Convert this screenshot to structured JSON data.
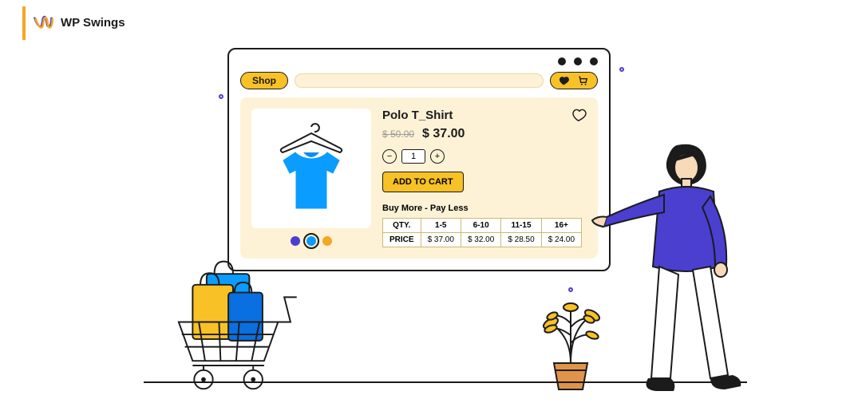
{
  "brand": {
    "name": "WP Swings"
  },
  "header": {
    "shop_label": "Shop"
  },
  "product": {
    "title": "Polo T_Shirt",
    "old_price": "$ 50.00",
    "new_price": "$ 37.00",
    "qty": "1",
    "add_to_cart": "ADD TO CART",
    "tier_title": "Buy More - Pay Less",
    "swatches": [
      "#4a3fcf",
      "#0a9cff",
      "#f5a623"
    ],
    "swatch_selected": 1,
    "table": {
      "headers": [
        "QTY.",
        "1-5",
        "6-10",
        "11-15",
        "16+"
      ],
      "row_label": "PRICE",
      "prices": [
        "$ 37.00",
        "$ 32.00",
        "$ 28.50",
        "$ 24.00"
      ]
    }
  }
}
